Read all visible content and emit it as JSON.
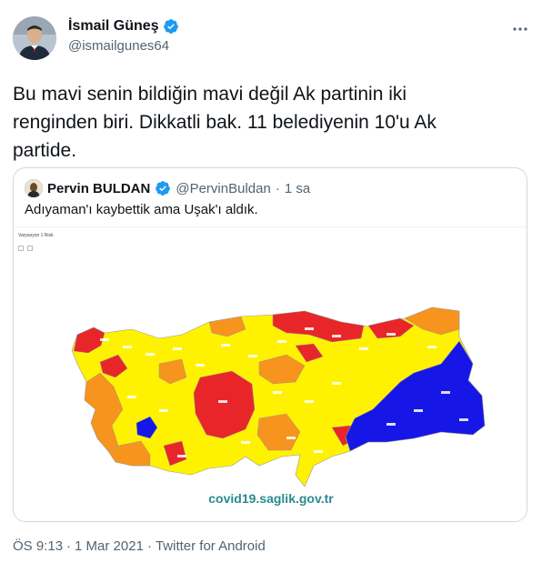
{
  "author": {
    "name": "İsmail Güneş",
    "handle": "@ismailgunes64"
  },
  "tweet": {
    "text": "Bu mavi senin bildiğin mavi değil Ak partinin iki\nrenginden biri. Dikkatli bak. 11 belediyenin 10'u Ak\npartide."
  },
  "quoted": {
    "name": "Pervin BULDAN",
    "handle": "@PervinBuldan",
    "separator": "·",
    "time": "1 sa",
    "text": "Adıyaman'ı kaybettik ama Uşak'ı aldık.",
    "map_caption": "Varyasyon 1 Risk",
    "map_footer": "covid19.saglik.gov.tr"
  },
  "meta": {
    "time": "ÖS 9:13",
    "sep1": "·",
    "date": "1 Mar 2021",
    "sep2": "·",
    "client": "Twitter for Android"
  },
  "colors": {
    "red": "#e8262a",
    "orange": "#f7941d",
    "yellow": "#fff200",
    "blue": "#1616e6",
    "verified": "#1d9bf0"
  },
  "icons": {
    "more": "more-icon",
    "verified": "verified-badge-icon"
  }
}
